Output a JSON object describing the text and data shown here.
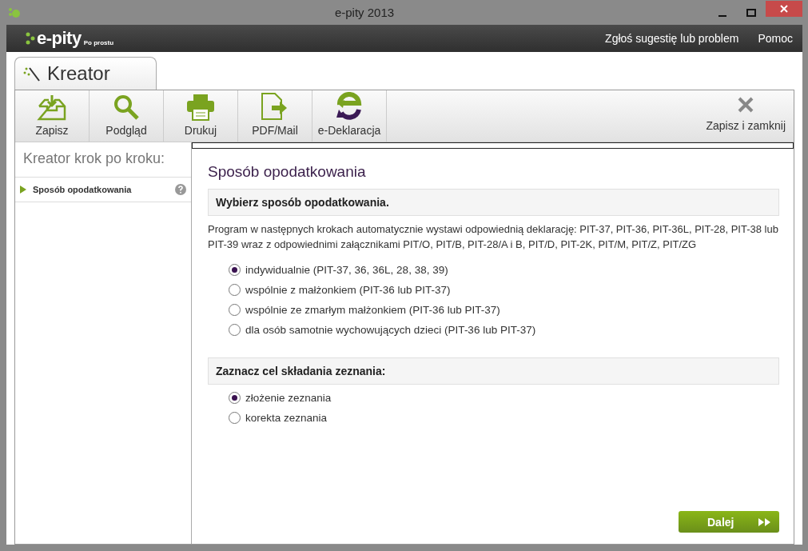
{
  "window": {
    "title": "e-pity 2013"
  },
  "header": {
    "logo": "e-pity",
    "tagline": "Po prostu",
    "links": [
      "Zgłoś sugestię lub problem",
      "Pomoc"
    ]
  },
  "tab": {
    "label": "Kreator"
  },
  "toolbar": [
    {
      "label": "Zapisz",
      "kind": "save"
    },
    {
      "label": "Podgląd",
      "kind": "preview"
    },
    {
      "label": "Drukuj",
      "kind": "print"
    },
    {
      "label": "PDF/Mail",
      "kind": "pdf"
    },
    {
      "label": "e-Deklaracja",
      "kind": "edecl"
    }
  ],
  "close_button": {
    "label": "Zapisz i zamknij"
  },
  "sidebar": {
    "title": "Kreator krok po kroku:",
    "items": [
      {
        "label": "Sposób opodatkowania",
        "selected": true
      }
    ]
  },
  "content": {
    "progress": {
      "level": 0
    },
    "title": "Sposób opodatkowania",
    "sections": [
      {
        "heading": "Wybierz sposób opodatkowania.",
        "description": "Program w następnych krokach automatycznie wystawi odpowiednią deklarację: PIT-37, PIT-36, PIT-36L, PIT-28, PIT-38 lub PIT-39 wraz z odpowiednimi załącznikami PIT/O, PIT/B, PIT-28/A i B, PIT/D, PIT-2K, PIT/M, PIT/Z, PIT/ZG",
        "options": [
          {
            "label": "indywidualnie (PIT-37, 36, 36L, 28, 38, 39)",
            "selected": true
          },
          {
            "label": "wspólnie z małżonkiem (PIT-36 lub PIT-37)",
            "selected": false
          },
          {
            "label": "wspólnie ze zmarłym małżonkiem (PIT-36 lub PIT-37)",
            "selected": false
          },
          {
            "label": "dla osób samotnie wychowujących dzieci (PIT-36 lub PIT-37)",
            "selected": false
          }
        ]
      },
      {
        "heading": "Zaznacz cel składania zeznania:",
        "options": [
          {
            "label": "złożenie zeznania",
            "selected": true
          },
          {
            "label": "korekta zeznania",
            "selected": false
          }
        ]
      }
    ],
    "next_button": {
      "label": "Dalej"
    }
  }
}
